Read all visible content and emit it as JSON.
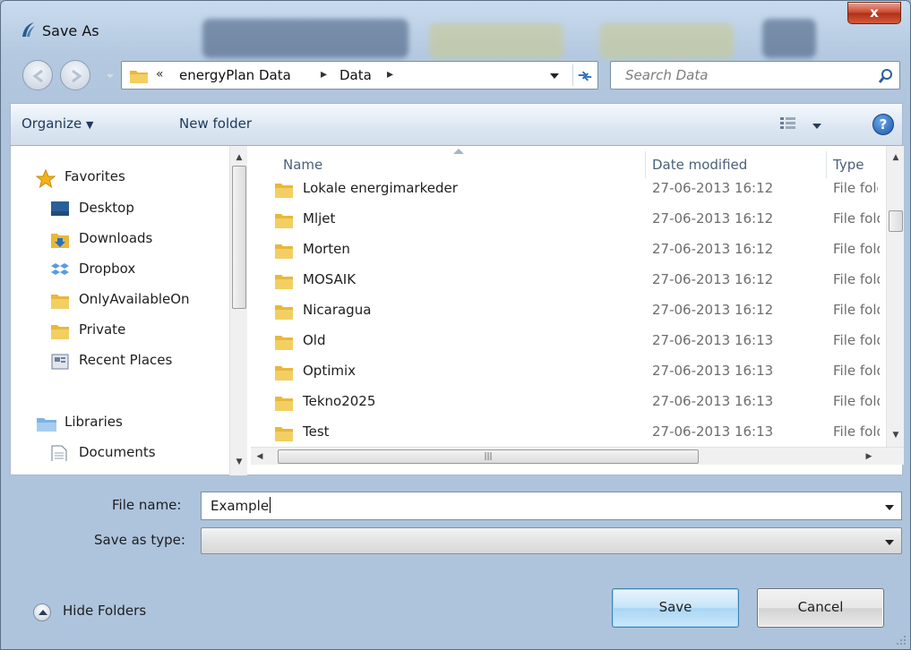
{
  "window": {
    "title": "Save As",
    "close_label": "x"
  },
  "address": {
    "overflow": "«",
    "crumbs": [
      "energyPlan Data",
      "Data"
    ],
    "search_placeholder": "Search Data"
  },
  "toolbar": {
    "organize_label": "Organize",
    "new_folder_label": "New folder",
    "help_label": "?"
  },
  "nav": {
    "favorites_label": "Favorites",
    "items": [
      {
        "label": "Desktop",
        "icon": "desktop-icon"
      },
      {
        "label": "Downloads",
        "icon": "downloads-icon"
      },
      {
        "label": "Dropbox",
        "icon": "dropbox-icon"
      },
      {
        "label": "OnlyAvailableOn",
        "icon": "folder-icon"
      },
      {
        "label": "Private",
        "icon": "folder-icon"
      },
      {
        "label": "Recent Places",
        "icon": "recent-places-icon"
      }
    ],
    "libraries_label": "Libraries",
    "library_items": [
      {
        "label": "Documents",
        "icon": "documents-icon"
      }
    ]
  },
  "columns": {
    "name": "Name",
    "date": "Date modified",
    "type": "Type"
  },
  "files": [
    {
      "name": "Lokale energimarkeder",
      "date": "27-06-2013 16:12",
      "type": "File fold"
    },
    {
      "name": "Mljet",
      "date": "27-06-2013 16:12",
      "type": "File fold"
    },
    {
      "name": "Morten",
      "date": "27-06-2013 16:12",
      "type": "File fold"
    },
    {
      "name": "MOSAIK",
      "date": "27-06-2013 16:12",
      "type": "File fold"
    },
    {
      "name": "Nicaragua",
      "date": "27-06-2013 16:12",
      "type": "File fold"
    },
    {
      "name": "Old",
      "date": "27-06-2013 16:13",
      "type": "File fold"
    },
    {
      "name": "Optimix",
      "date": "27-06-2013 16:13",
      "type": "File fold"
    },
    {
      "name": "Tekno2025",
      "date": "27-06-2013 16:13",
      "type": "File fold"
    },
    {
      "name": "Test",
      "date": "27-06-2013 16:13",
      "type": "File fold"
    }
  ],
  "form": {
    "file_name_label": "File name:",
    "file_name_value": "Example",
    "save_type_label": "Save as type:",
    "save_type_value": ""
  },
  "footer": {
    "hide_folders_label": "Hide Folders",
    "save_label": "Save",
    "cancel_label": "Cancel"
  },
  "colors": {
    "accent": "#1e395b",
    "folder": "#e8b83a",
    "close": "#c8432b"
  }
}
